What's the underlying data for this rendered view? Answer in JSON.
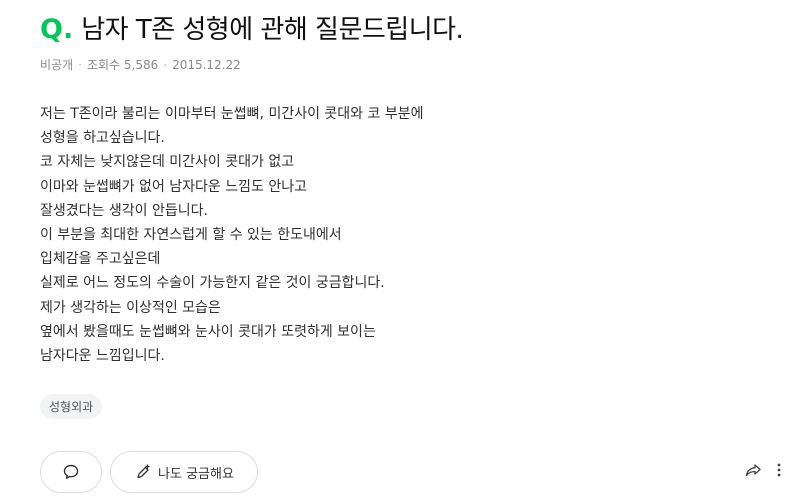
{
  "question": {
    "q_mark": "Q.",
    "title": "남자 T존 성형에 관해 질문드립니다.",
    "meta": {
      "visibility": "비공개",
      "views": "조회수 5,586",
      "date": "2015.12.22"
    },
    "body_lines": [
      "저는 T존이라 불리는 이마부터 눈썹뼈, 미간사이 콧대와 코 부분에",
      "성형을 하고싶습니다.",
      "코 자체는 낮지않은데 미간사이 콧대가 없고",
      "이마와 눈썹뼈가 없어 남자다운 느낌도 안나고",
      "잘생겼다는 생각이 안듭니다.",
      "이 부분을 최대한 자연스럽게 할 수 있는 한도내에서",
      "입체감을 주고싶은데",
      "실제로 어느 정도의 수술이 가능한지 같은 것이 궁금합니다.",
      "제가 생각하는 이상적인 모습은",
      "옆에서 봤을때도 눈썹뼈와 눈사이 콧대가 또렷하게 보이는",
      "남자다운 느낌입니다."
    ],
    "tag": "성형외과"
  },
  "actions": {
    "comment_icon": "speech-bubble-icon",
    "curious_icon": "pencil-plus-icon",
    "curious_label": "나도 궁금해요",
    "share_icon": "share-arrow-icon",
    "more_icon": "vertical-dots-icon"
  },
  "colors": {
    "accent": "#03c75a",
    "meta": "#8a8a8a",
    "tag_bg": "#f2f3f5",
    "border": "#dedede"
  }
}
